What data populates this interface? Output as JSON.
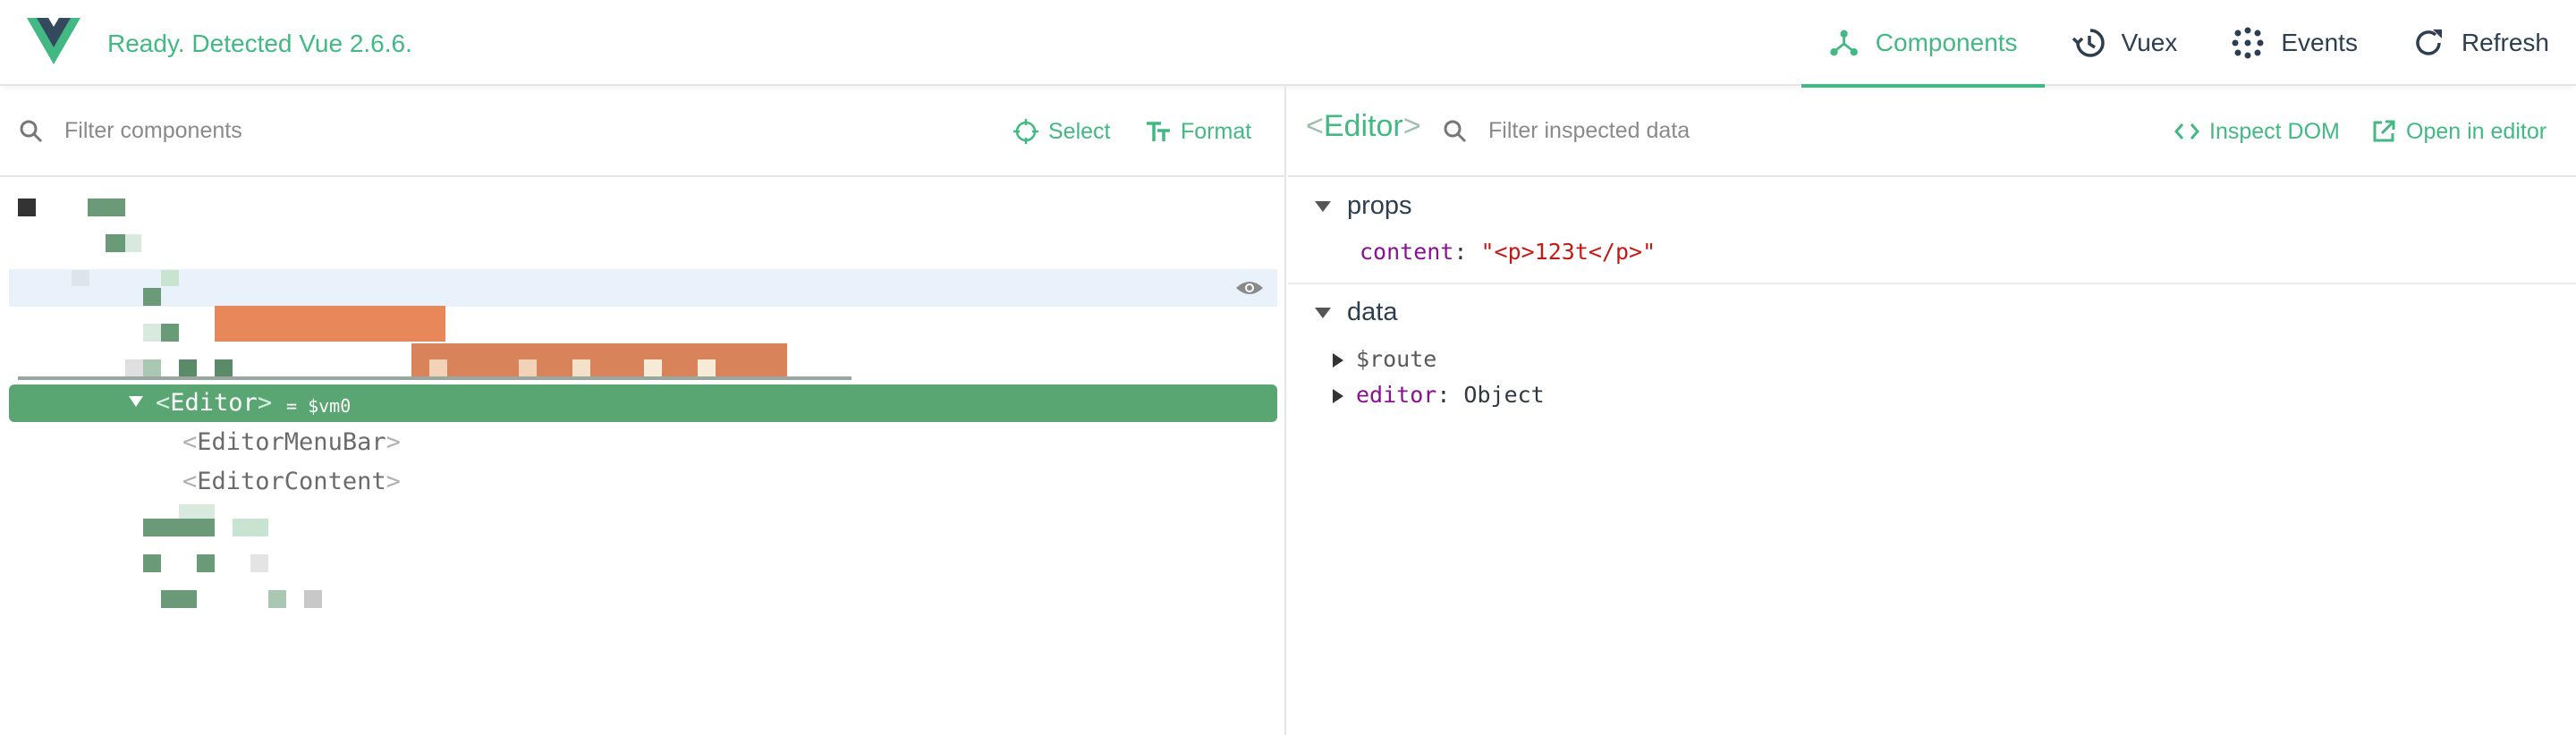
{
  "header": {
    "status": "Ready. Detected Vue 2.6.6.",
    "nav": [
      {
        "label": "Components",
        "icon": "components-icon",
        "active": true
      },
      {
        "label": "Vuex",
        "icon": "history-icon",
        "active": false
      },
      {
        "label": "Events",
        "icon": "events-icon",
        "active": false
      },
      {
        "label": "Refresh",
        "icon": "refresh-icon",
        "active": false
      }
    ]
  },
  "left": {
    "filter_placeholder": "Filter components",
    "select_label": "Select",
    "format_label": "Format",
    "tree": {
      "selected": {
        "name": "Editor",
        "vm": "= $vm0"
      },
      "children": [
        "EditorMenuBar",
        "EditorContent"
      ]
    }
  },
  "right": {
    "component_name": "Editor",
    "filter_placeholder": "Filter inspected data",
    "inspect_dom_label": "Inspect DOM",
    "open_editor_label": "Open in editor",
    "props": {
      "title": "props",
      "key": "content",
      "value": "\"<p>123t</p>\""
    },
    "data": {
      "title": "data",
      "items": [
        {
          "key": "$route",
          "value": ""
        },
        {
          "key": "editor",
          "value": "Object"
        }
      ]
    }
  },
  "colors": {
    "accent": "#42b983",
    "selected_row": "#5aa672",
    "hover_row": "#e9f1fb"
  }
}
